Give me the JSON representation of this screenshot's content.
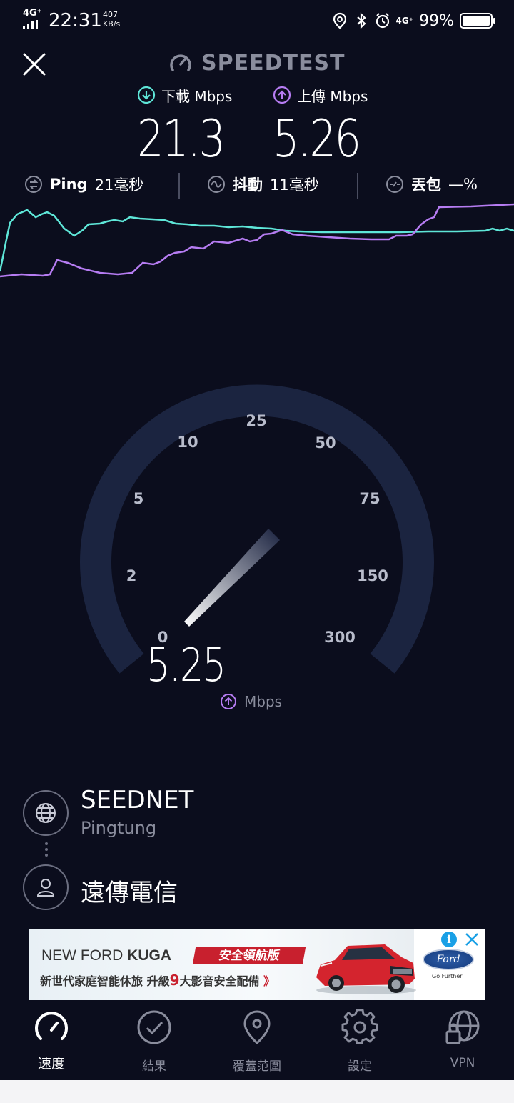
{
  "status_bar": {
    "network": "4G⁺",
    "time": "22:31",
    "speed_value": "407",
    "speed_unit": "KB/s",
    "network_right": "4G⁺",
    "battery": "99%"
  },
  "header": {
    "title": "SPEEDTEST"
  },
  "download": {
    "label": "下載 Mbps",
    "value": "21.3",
    "color": "#5ee6d8"
  },
  "upload": {
    "label": "上傳 Mbps",
    "value": "5.26",
    "color": "#b67cf2"
  },
  "ping": {
    "label": "Ping",
    "value": "21毫秒"
  },
  "jitter": {
    "label": "抖動",
    "value": "11毫秒"
  },
  "loss": {
    "label": "丟包",
    "value": "—%"
  },
  "gauge": {
    "ticks": [
      "0",
      "2",
      "5",
      "10",
      "25",
      "50",
      "75",
      "150",
      "300"
    ],
    "current_value": 5.25,
    "value_text": "5.25",
    "unit": "Mbps"
  },
  "server": {
    "name": "SEEDNET",
    "location": "Pingtung"
  },
  "isp": {
    "name": "遠傳電信"
  },
  "ad": {
    "title_prefix": "NEW FORD ",
    "title_model": "KUGA",
    "tag": "安全領航版",
    "subtitle_a": "新世代家庭智能休旅  升級",
    "subtitle_num": "9",
    "subtitle_b": "大影音安全配備",
    "subtitle_arrow": "》",
    "brand": "Ford",
    "slogan": "Go Further",
    "info": "i"
  },
  "nav": {
    "items": [
      {
        "label": "速度",
        "icon": "speedometer-icon",
        "active": true
      },
      {
        "label": "結果",
        "icon": "check-circle-icon",
        "active": false
      },
      {
        "label": "覆蓋范圍",
        "icon": "map-pin-icon",
        "active": false
      },
      {
        "label": "設定",
        "icon": "gear-icon",
        "active": false
      },
      {
        "label": "VPN",
        "icon": "vpn-globe-lock-icon",
        "active": false
      }
    ]
  }
}
